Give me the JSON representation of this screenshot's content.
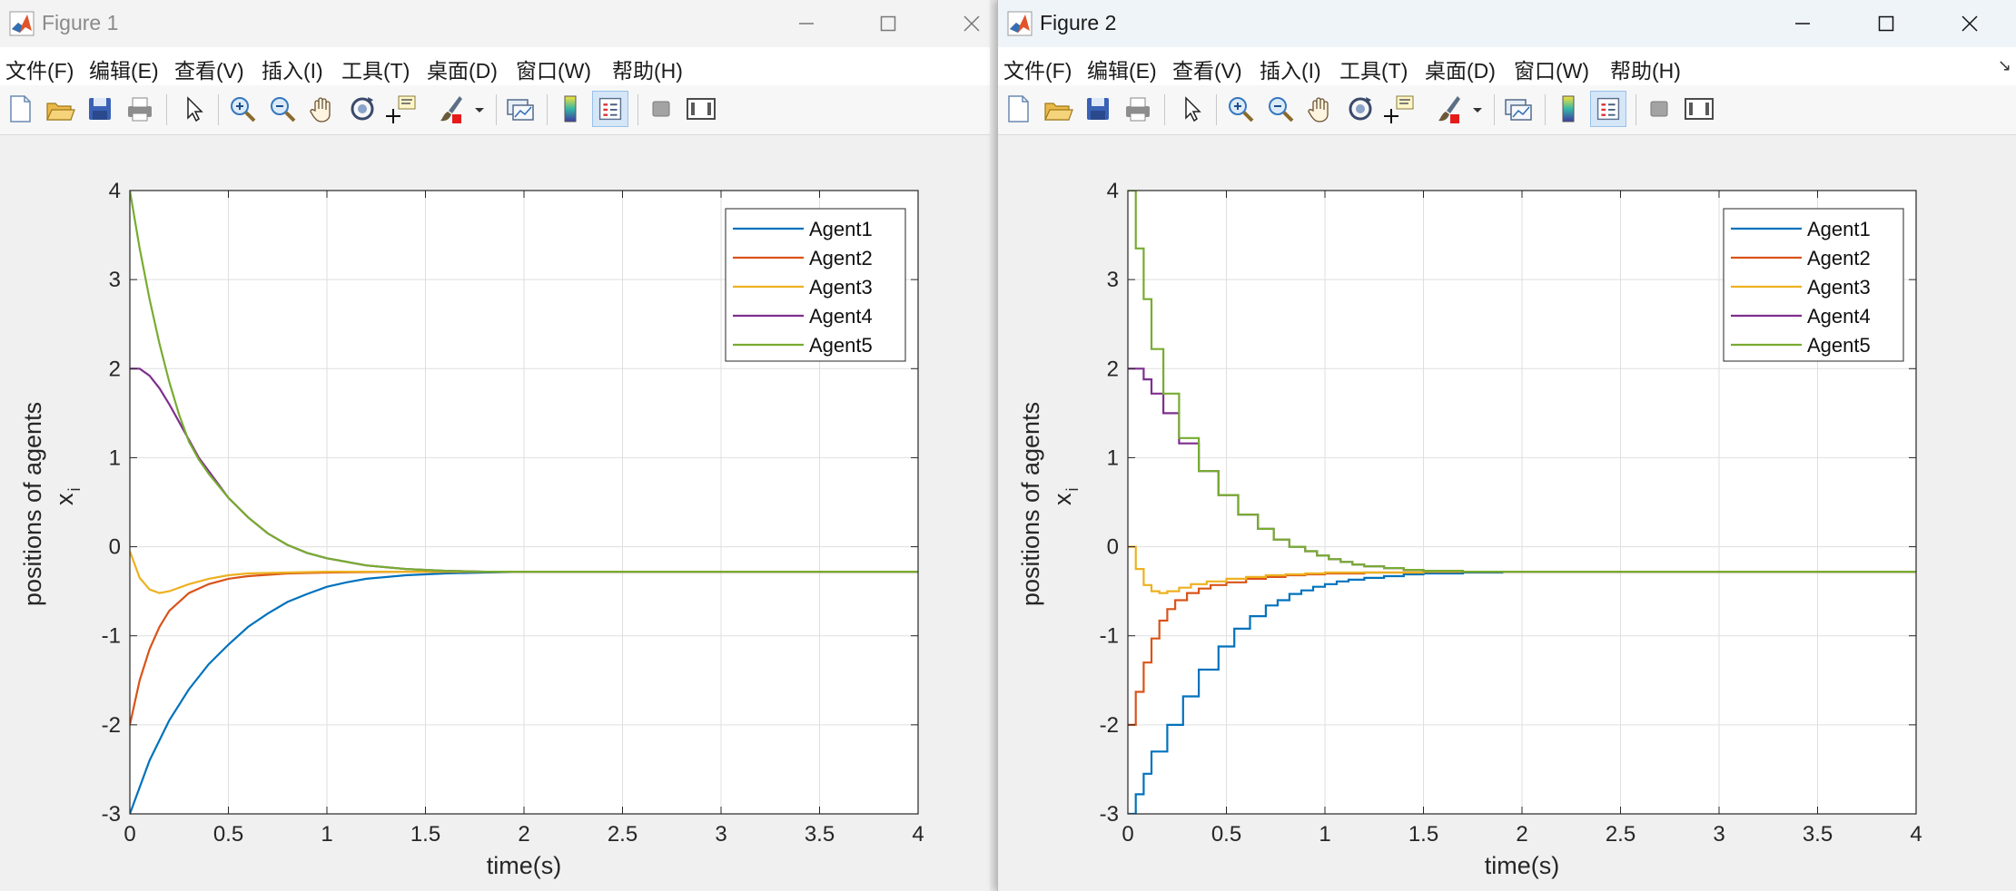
{
  "windows": [
    {
      "id": "win1",
      "title": "Figure 1",
      "active": false,
      "menu": [
        "文件(F)",
        "编辑(E)",
        "查看(V)",
        "插入(I)",
        "工具(T)",
        "桌面(D)",
        "窗口(W)",
        "帮助(H)"
      ],
      "toolbar_icons": [
        "new-figure-icon",
        "open-file-icon",
        "save-icon",
        "print-icon",
        "select-arrow-icon",
        "zoom-in-icon",
        "zoom-out-icon",
        "pan-hand-icon",
        "rotate-3d-icon",
        "data-cursor-icon",
        "brush-icon",
        "brush-dropdown-icon",
        "link-plot-icon",
        "colorbar-icon",
        "legend-icon",
        "hide-plot-tools-icon",
        "show-plot-tools-icon"
      ]
    },
    {
      "id": "win2",
      "title": "Figure 2",
      "active": true,
      "menu": [
        "文件(F)",
        "编辑(E)",
        "查看(V)",
        "插入(I)",
        "工具(T)",
        "桌面(D)",
        "窗口(W)",
        "帮助(H)"
      ],
      "toolbar_icons": [
        "new-figure-icon",
        "open-file-icon",
        "save-icon",
        "print-icon",
        "select-arrow-icon",
        "zoom-in-icon",
        "zoom-out-icon",
        "pan-hand-icon",
        "rotate-3d-icon",
        "data-cursor-icon",
        "brush-icon",
        "brush-dropdown-icon",
        "link-plot-icon",
        "colorbar-icon",
        "legend-icon",
        "hide-plot-tools-icon",
        "show-plot-tools-icon"
      ]
    }
  ],
  "colors": {
    "Agent1": "#0072BD",
    "Agent2": "#D95319",
    "Agent3": "#EDB120",
    "Agent4": "#7E2F8E",
    "Agent5": "#77AC30"
  },
  "chart_data": [
    {
      "type": "line",
      "style": "continuous",
      "xlabel": "time(s)",
      "ylabel": "positions of agents",
      "ylabel_sub": "x",
      "ylabel_sub_index": "i",
      "xlim": [
        0,
        4
      ],
      "ylim": [
        -3,
        4
      ],
      "xticks": [
        0,
        0.5,
        1,
        1.5,
        2,
        2.5,
        3,
        3.5,
        4
      ],
      "xtick_labels": [
        "0",
        "0.5",
        "1",
        "1.5",
        "2",
        "2.5",
        "3",
        "3.5",
        "4"
      ],
      "yticks": [
        -3,
        -2,
        -1,
        0,
        1,
        2,
        3,
        4
      ],
      "ytick_labels": [
        "-3",
        "-2",
        "-1",
        "0",
        "1",
        "2",
        "3",
        "4"
      ],
      "grid": true,
      "legend_position": "top-right",
      "series": [
        {
          "name": "Agent1",
          "x": [
            0,
            0.1,
            0.2,
            0.3,
            0.4,
            0.5,
            0.6,
            0.7,
            0.8,
            0.9,
            1.0,
            1.1,
            1.2,
            1.4,
            1.6,
            1.8,
            2.0,
            4.0
          ],
          "y": [
            -3,
            -2.4,
            -1.95,
            -1.6,
            -1.32,
            -1.1,
            -0.9,
            -0.75,
            -0.62,
            -0.53,
            -0.45,
            -0.4,
            -0.36,
            -0.32,
            -0.3,
            -0.29,
            -0.28,
            -0.28
          ]
        },
        {
          "name": "Agent2",
          "x": [
            0,
            0.05,
            0.1,
            0.15,
            0.2,
            0.3,
            0.4,
            0.5,
            0.6,
            0.8,
            1.0,
            1.4,
            2.0,
            4.0
          ],
          "y": [
            -2,
            -1.5,
            -1.15,
            -0.9,
            -0.72,
            -0.52,
            -0.42,
            -0.36,
            -0.33,
            -0.3,
            -0.29,
            -0.28,
            -0.28,
            -0.28
          ]
        },
        {
          "name": "Agent3",
          "x": [
            0,
            0.05,
            0.1,
            0.15,
            0.2,
            0.3,
            0.4,
            0.5,
            0.6,
            0.8,
            1.0,
            1.4,
            2.0,
            4.0
          ],
          "y": [
            -0.05,
            -0.35,
            -0.48,
            -0.52,
            -0.5,
            -0.42,
            -0.36,
            -0.32,
            -0.3,
            -0.29,
            -0.28,
            -0.28,
            -0.28,
            -0.28
          ]
        },
        {
          "name": "Agent4",
          "x": [
            0,
            0.05,
            0.1,
            0.15,
            0.2,
            0.25,
            0.3,
            0.35,
            0.4,
            0.5,
            0.6,
            0.7,
            0.8,
            0.9,
            1.0,
            1.2,
            1.4,
            1.6,
            1.8,
            2.0,
            4.0
          ],
          "y": [
            2,
            2,
            1.92,
            1.78,
            1.6,
            1.4,
            1.2,
            1.0,
            0.85,
            0.55,
            0.33,
            0.15,
            0.02,
            -0.07,
            -0.13,
            -0.21,
            -0.25,
            -0.27,
            -0.28,
            -0.28,
            -0.28
          ]
        },
        {
          "name": "Agent5",
          "x": [
            0,
            0.05,
            0.1,
            0.15,
            0.2,
            0.25,
            0.3,
            0.35,
            0.4,
            0.5,
            0.6,
            0.7,
            0.8,
            0.9,
            1.0,
            1.2,
            1.4,
            1.6,
            1.8,
            2.0,
            4.0
          ],
          "y": [
            4,
            3.35,
            2.78,
            2.28,
            1.85,
            1.48,
            1.18,
            0.98,
            0.82,
            0.55,
            0.33,
            0.15,
            0.02,
            -0.07,
            -0.13,
            -0.21,
            -0.25,
            -0.27,
            -0.28,
            -0.28,
            -0.28
          ]
        }
      ]
    },
    {
      "type": "line",
      "style": "stairs",
      "xlabel": "time(s)",
      "ylabel": "positions of agents",
      "ylabel_sub": "x",
      "ylabel_sub_index": "i",
      "xlim": [
        0,
        4
      ],
      "ylim": [
        -3,
        4
      ],
      "xticks": [
        0,
        0.5,
        1,
        1.5,
        2,
        2.5,
        3,
        3.5,
        4
      ],
      "xtick_labels": [
        "0",
        "0.5",
        "1",
        "1.5",
        "2",
        "2.5",
        "3",
        "3.5",
        "4"
      ],
      "yticks": [
        -3,
        -2,
        -1,
        0,
        1,
        2,
        3,
        4
      ],
      "ytick_labels": [
        "-3",
        "-2",
        "-1",
        "0",
        "1",
        "2",
        "3",
        "4"
      ],
      "grid": true,
      "legend_position": "top-right",
      "series": [
        {
          "name": "Agent1",
          "x": [
            0,
            0.04,
            0.08,
            0.12,
            0.2,
            0.28,
            0.36,
            0.46,
            0.54,
            0.62,
            0.7,
            0.76,
            0.82,
            0.88,
            0.94,
            1.0,
            1.06,
            1.12,
            1.2,
            1.3,
            1.4,
            1.5,
            1.7,
            1.9,
            4.0
          ],
          "y": [
            -3,
            -2.78,
            -2.55,
            -2.3,
            -2.0,
            -1.68,
            -1.38,
            -1.12,
            -0.92,
            -0.78,
            -0.66,
            -0.6,
            -0.53,
            -0.49,
            -0.45,
            -0.42,
            -0.39,
            -0.37,
            -0.35,
            -0.33,
            -0.31,
            -0.3,
            -0.29,
            -0.28,
            -0.28
          ]
        },
        {
          "name": "Agent2",
          "x": [
            0,
            0.04,
            0.08,
            0.12,
            0.16,
            0.2,
            0.24,
            0.3,
            0.36,
            0.42,
            0.5,
            0.6,
            0.7,
            0.8,
            0.9,
            1.0,
            1.2,
            1.5,
            1.9,
            4.0
          ],
          "y": [
            -2,
            -1.63,
            -1.3,
            -1.03,
            -0.83,
            -0.7,
            -0.6,
            -0.52,
            -0.47,
            -0.43,
            -0.4,
            -0.36,
            -0.34,
            -0.32,
            -0.31,
            -0.3,
            -0.29,
            -0.28,
            -0.28,
            -0.28
          ]
        },
        {
          "name": "Agent3",
          "x": [
            0,
            0.04,
            0.08,
            0.12,
            0.16,
            0.2,
            0.26,
            0.32,
            0.4,
            0.5,
            0.6,
            0.7,
            0.8,
            0.9,
            1.0,
            1.2,
            1.5,
            1.9,
            4.0
          ],
          "y": [
            0,
            -0.25,
            -0.43,
            -0.5,
            -0.52,
            -0.5,
            -0.46,
            -0.42,
            -0.39,
            -0.36,
            -0.34,
            -0.32,
            -0.31,
            -0.3,
            -0.29,
            -0.29,
            -0.28,
            -0.28,
            -0.28
          ]
        },
        {
          "name": "Agent4",
          "x": [
            0,
            0.08,
            0.12,
            0.18,
            0.26,
            0.36,
            0.46,
            0.56,
            0.66,
            0.74,
            0.82,
            0.9,
            0.96,
            1.02,
            1.08,
            1.14,
            1.2,
            1.3,
            1.4,
            1.5,
            1.7,
            1.9,
            4.0
          ],
          "y": [
            2,
            1.88,
            1.72,
            1.5,
            1.16,
            0.85,
            0.58,
            0.36,
            0.2,
            0.08,
            0.0,
            -0.05,
            -0.1,
            -0.14,
            -0.17,
            -0.2,
            -0.22,
            -0.24,
            -0.26,
            -0.27,
            -0.28,
            -0.28,
            -0.28
          ]
        },
        {
          "name": "Agent5",
          "x": [
            0,
            0.04,
            0.08,
            0.12,
            0.18,
            0.26,
            0.36,
            0.46,
            0.56,
            0.66,
            0.74,
            0.82,
            0.9,
            0.96,
            1.02,
            1.08,
            1.14,
            1.2,
            1.3,
            1.4,
            1.5,
            1.7,
            1.9,
            4.0
          ],
          "y": [
            4,
            3.35,
            2.78,
            2.22,
            1.72,
            1.22,
            0.85,
            0.58,
            0.36,
            0.2,
            0.08,
            0.0,
            -0.05,
            -0.1,
            -0.14,
            -0.17,
            -0.2,
            -0.22,
            -0.24,
            -0.26,
            -0.27,
            -0.28,
            -0.28,
            -0.28
          ]
        }
      ]
    }
  ]
}
